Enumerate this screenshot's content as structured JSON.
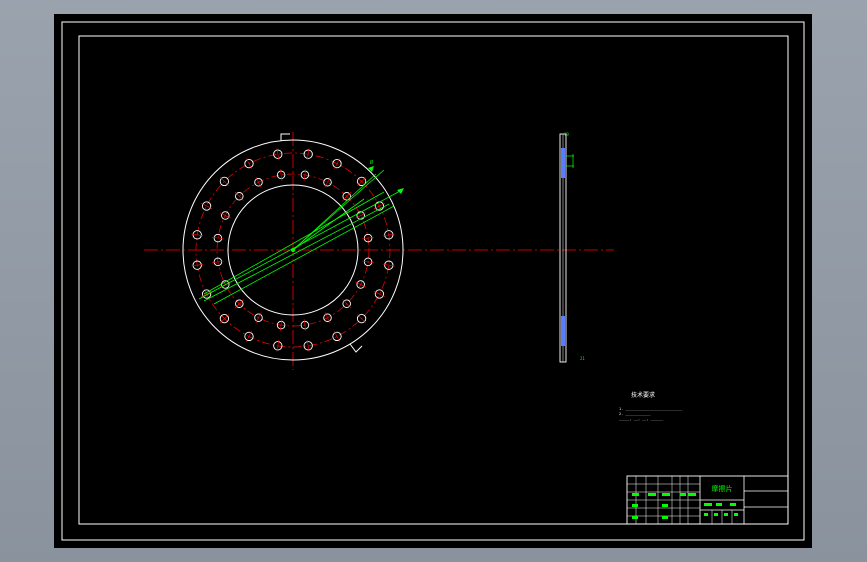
{
  "viewer": {
    "background_color": "#8e979f",
    "sheet_color": "#000000"
  },
  "colors": {
    "outline": "#ffffff",
    "centerline": "#ff0000",
    "dimension": "#00ff00"
  },
  "drawing": {
    "front_view": {
      "bolt_hole_count": 20,
      "inner_hole_count": 20
    },
    "section_view": {
      "label_top": "19",
      "label_bottom": "21"
    }
  },
  "notes": {
    "heading": "技术要求",
    "lines": [
      "1. ___________________________",
      "2. ____________",
      "_____, __, __, ______"
    ]
  },
  "title_block": {
    "part_name": "摩擦片"
  }
}
